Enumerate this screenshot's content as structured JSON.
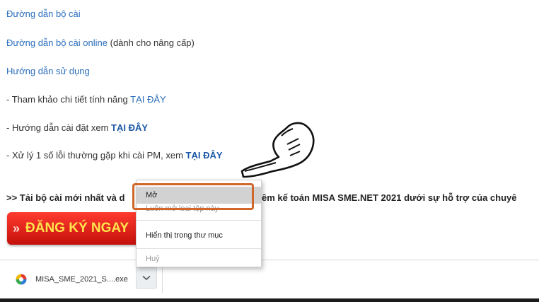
{
  "links": {
    "installer": "Đường dẫn bộ cài",
    "installer_online": "Đường dẫn bộ cài online",
    "installer_online_suffix": " (dành cho nâng cấp)",
    "user_guide": "Hướng dẫn sử dụng"
  },
  "lines": [
    {
      "prefix": "- Tham khảo chi tiết tính năng ",
      "link": "TẠI ĐÂY"
    },
    {
      "prefix": "- Hướng dẫn cài đặt xem ",
      "link": "TẠI ĐÂY"
    },
    {
      "prefix": "- Xử lý 1 số lỗi thường gặp khi cài PM, xem ",
      "link": "TẠI ĐÂY"
    }
  ],
  "promo": {
    "left": ">> Tải bộ cài mới nhất và d",
    "right": "êm kế toán MISA SME.NET 2021 dưới sự hỗ trợ của chuyê"
  },
  "register_button": {
    "chevron": "»",
    "label": "ĐĂNG KÝ NGAY"
  },
  "context_menu": {
    "items": [
      "Mở",
      "Luôn mở loại tệp này",
      "Hiển thị trong thư mục",
      "Huỷ"
    ]
  },
  "download_bar": {
    "file_name": "MISA_SME_2021_S....exe",
    "chevron": "⌄"
  },
  "colors": {
    "link": "#2a6ebb",
    "highlight_outline": "#d0662a",
    "button_red": "#e0201a",
    "button_text": "#ffe34d"
  }
}
